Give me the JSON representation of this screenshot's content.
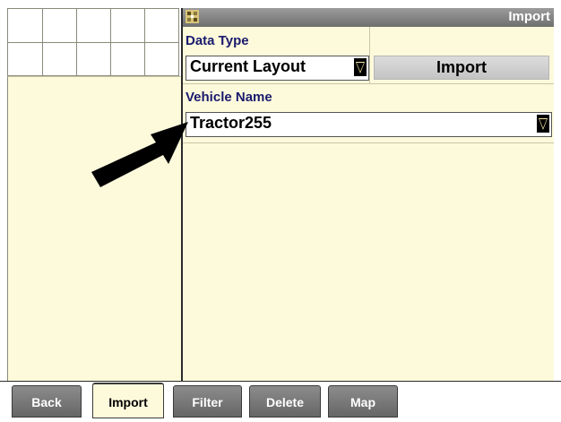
{
  "window": {
    "title": "Import"
  },
  "data_type": {
    "label": "Data Type",
    "selected": "Current Layout",
    "dropdown_icon": "triangle-down"
  },
  "import_button": {
    "label": "Import"
  },
  "vehicle_name": {
    "label": "Vehicle Name",
    "selected": "Tractor255",
    "dropdown_icon": "triangle-down"
  },
  "tabs": [
    {
      "label": "Back",
      "active": false
    },
    {
      "label": "Import",
      "active": true
    },
    {
      "label": "Filter",
      "active": false
    },
    {
      "label": "Delete",
      "active": false
    },
    {
      "label": "Map",
      "active": false
    }
  ],
  "colors": {
    "panel_bg": "#fdfadc",
    "label_text": "#1a1a6e",
    "title_bar": "#7f7f7f",
    "tab_inactive": "#777777"
  }
}
